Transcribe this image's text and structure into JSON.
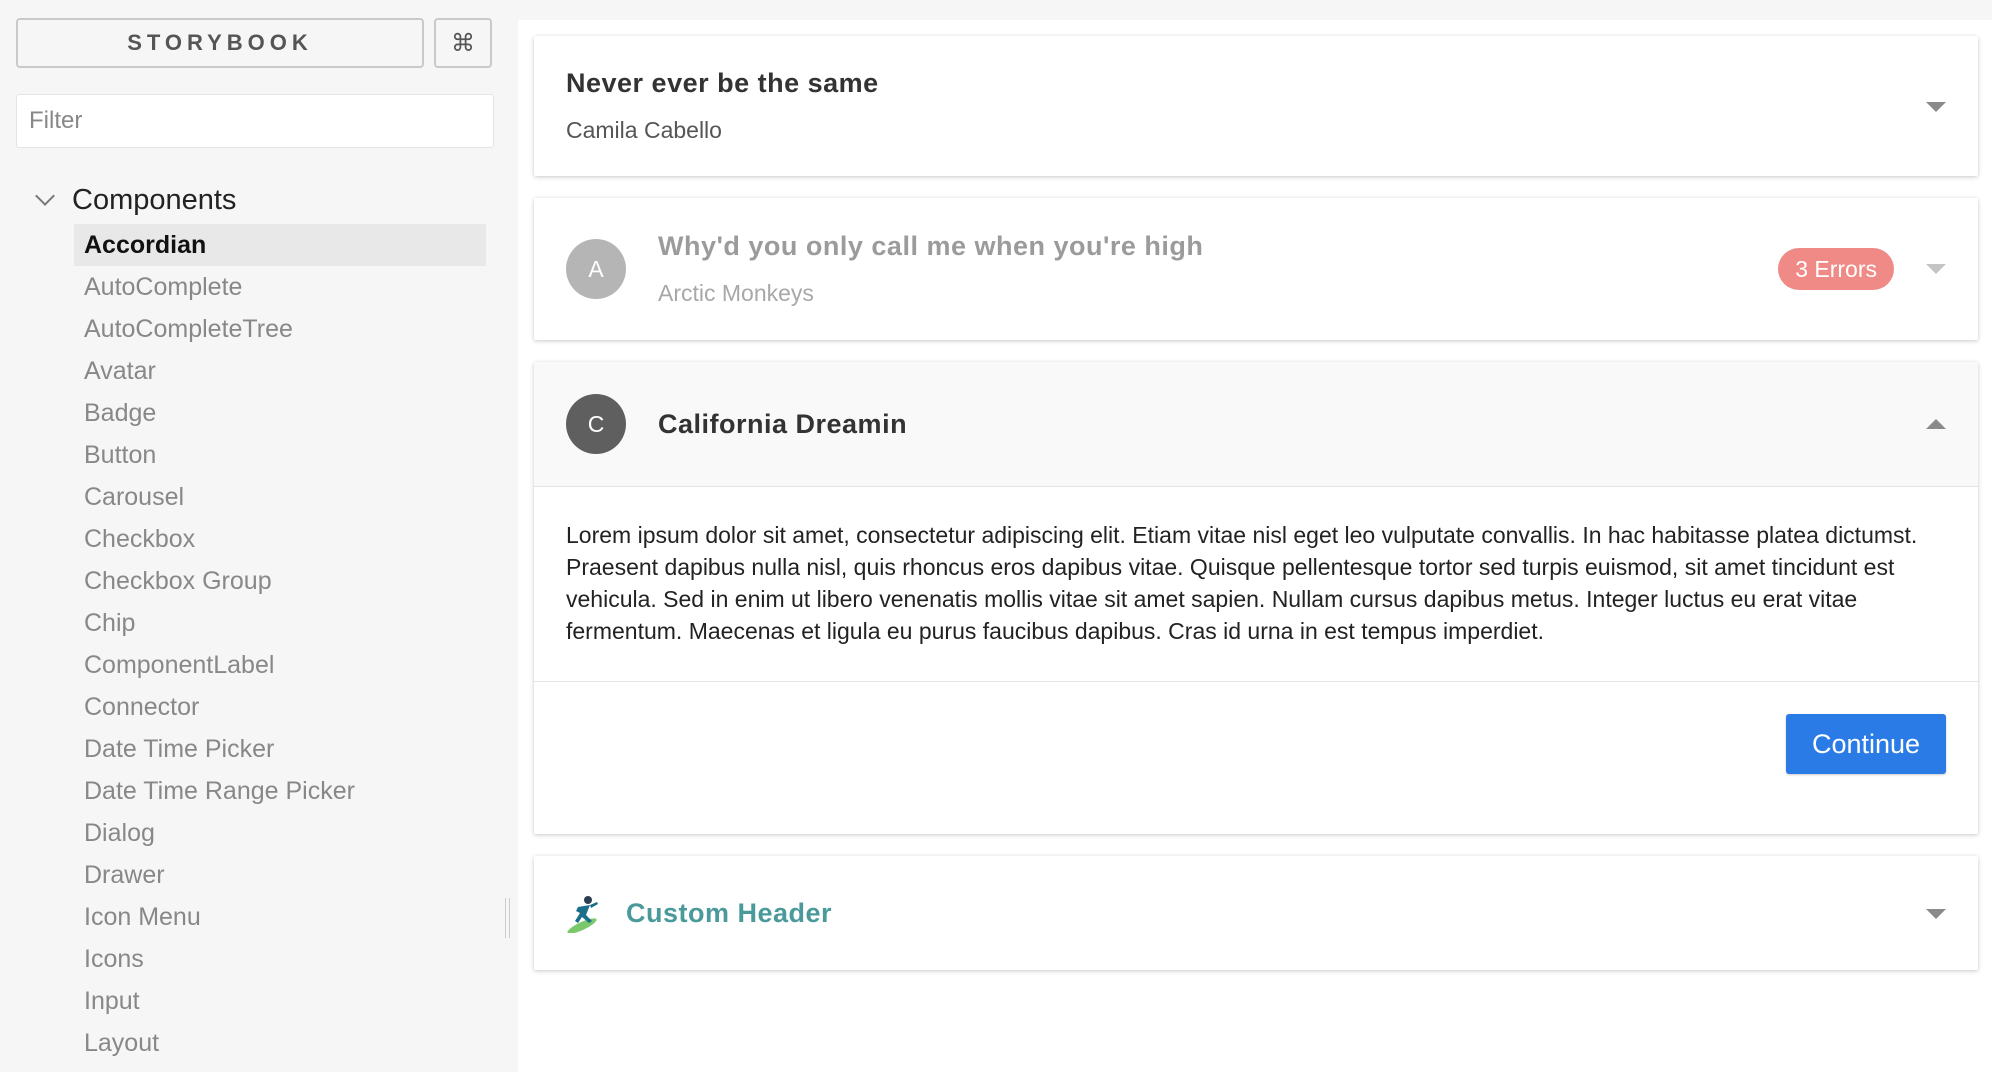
{
  "sidebar": {
    "brand_label": "STORYBOOK",
    "shortcut_label": "⌘",
    "filter_placeholder": "Filter",
    "tree": {
      "root_label": "Components",
      "items": [
        {
          "label": "Accordian",
          "selected": true
        },
        {
          "label": "AutoComplete"
        },
        {
          "label": "AutoCompleteTree"
        },
        {
          "label": "Avatar"
        },
        {
          "label": "Badge"
        },
        {
          "label": "Button"
        },
        {
          "label": "Carousel"
        },
        {
          "label": "Checkbox"
        },
        {
          "label": "Checkbox Group"
        },
        {
          "label": "Chip"
        },
        {
          "label": "ComponentLabel"
        },
        {
          "label": "Connector"
        },
        {
          "label": "Date Time Picker"
        },
        {
          "label": "Date Time Range Picker"
        },
        {
          "label": "Dialog"
        },
        {
          "label": "Drawer"
        },
        {
          "label": "Icon Menu"
        },
        {
          "label": "Icons"
        },
        {
          "label": "Input"
        },
        {
          "label": "Layout"
        }
      ]
    }
  },
  "accordion": {
    "panel1": {
      "title": "Never ever be the same",
      "subtitle": "Camila Cabello"
    },
    "panel2": {
      "avatar_letter": "A",
      "title": "Why'd you only call me when you're high",
      "subtitle": "Arctic Monkeys",
      "badge": "3 Errors"
    },
    "panel3": {
      "avatar_letter": "C",
      "title": "California Dreamin",
      "body": "Lorem ipsum dolor sit amet, consectetur adipiscing elit. Etiam vitae nisl eget leo vulputate convallis. In hac habitasse platea dictumst. Praesent dapibus nulla nisl, quis rhoncus eros dapibus vitae. Quisque pellentesque tortor sed turpis euismod, sit amet tincidunt est vehicula. Sed in enim ut libero venenatis mollis vitae sit amet sapien. Nullam cursus dapibus metus. Integer luctus eu erat vitae fermentum. Maecenas et ligula eu purus faucibus dapibus. Cras id urna in est tempus imperdiet.",
      "action_label": "Continue"
    },
    "panel4": {
      "title": "Custom Header",
      "icon": "surfer-icon"
    }
  },
  "colors": {
    "accent_blue": "#2a7be6",
    "error_badge": "#f08a87",
    "custom_header_teal": "#4a9a9c",
    "avatar_disabled": "#b5b5b5",
    "avatar_active": "#5f5f5f"
  }
}
